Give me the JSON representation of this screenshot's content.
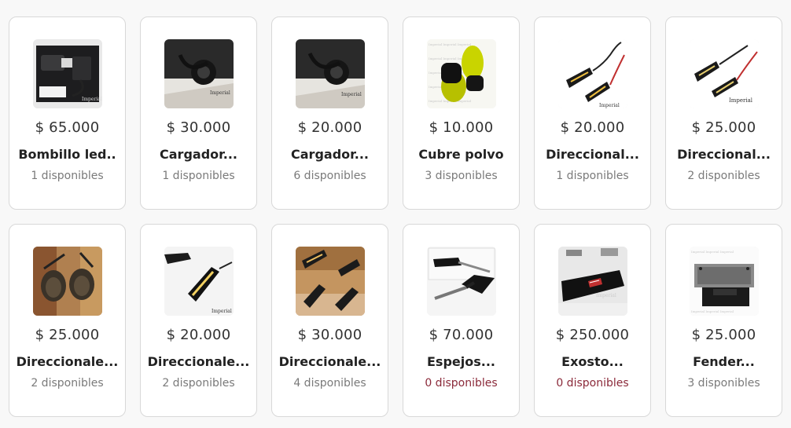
{
  "products": [
    {
      "price": "$ 65.000",
      "name": "Bombillo led..",
      "stock": "1 disponibles",
      "thumb_icon": "led-bulb-kit-image",
      "out_of_stock": false
    },
    {
      "price": "$ 30.000",
      "name": "Cargador...",
      "stock": "1 disponibles",
      "thumb_icon": "usb-charger-image",
      "out_of_stock": false
    },
    {
      "price": "$ 20.000",
      "name": "Cargador...",
      "stock": "6 disponibles",
      "thumb_icon": "usb-charger-image",
      "out_of_stock": false
    },
    {
      "price": "$ 10.000",
      "name": "Cubre polvo",
      "stock": "3 disponibles",
      "thumb_icon": "dust-cover-image",
      "out_of_stock": false
    },
    {
      "price": "$ 20.000",
      "name": "Direccional...",
      "stock": "1 disponibles",
      "thumb_icon": "turn-signal-image",
      "out_of_stock": false
    },
    {
      "price": "$ 25.000",
      "name": "Direccional...",
      "stock": "2 disponibles",
      "thumb_icon": "turn-signal-image",
      "out_of_stock": false
    },
    {
      "price": "$ 25.000",
      "name": "Direccionale...",
      "stock": "2 disponibles",
      "thumb_icon": "round-turn-signals-image",
      "out_of_stock": false
    },
    {
      "price": "$ 20.000",
      "name": "Direccionale...",
      "stock": "2 disponibles",
      "thumb_icon": "turn-signal-image",
      "out_of_stock": false
    },
    {
      "price": "$ 30.000",
      "name": "Direccionale...",
      "stock": "4 disponibles",
      "thumb_icon": "turn-signals-set-image",
      "out_of_stock": false
    },
    {
      "price": "$ 70.000",
      "name": "Espejos...",
      "stock": "0 disponibles",
      "thumb_icon": "mirrors-image",
      "out_of_stock": true
    },
    {
      "price": "$ 250.000",
      "name": "Exosto...",
      "stock": "0 disponibles",
      "thumb_icon": "exhaust-image",
      "out_of_stock": true
    },
    {
      "price": "$ 25.000",
      "name": "Fender...",
      "stock": "3 disponibles",
      "thumb_icon": "fender-image",
      "out_of_stock": false
    }
  ],
  "colors": {
    "out_of_stock": "#8b2a3a",
    "in_stock": "#7a7a7a"
  }
}
